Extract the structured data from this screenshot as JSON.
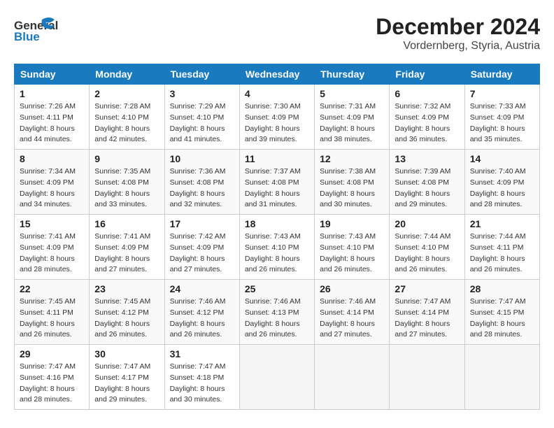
{
  "header": {
    "logo": {
      "general": "General",
      "blue": "Blue"
    },
    "title": "December 2024",
    "subtitle": "Vordernberg, Styria, Austria"
  },
  "calendar": {
    "days_of_week": [
      "Sunday",
      "Monday",
      "Tuesday",
      "Wednesday",
      "Thursday",
      "Friday",
      "Saturday"
    ],
    "weeks": [
      [
        {
          "day": "",
          "empty": true
        },
        {
          "day": "",
          "empty": true
        },
        {
          "day": "",
          "empty": true
        },
        {
          "day": "",
          "empty": true
        },
        {
          "day": "",
          "empty": true
        },
        {
          "day": "",
          "empty": true
        },
        {
          "day": "",
          "empty": true
        }
      ],
      [
        {
          "day": "1",
          "sunrise": "7:26 AM",
          "sunset": "4:11 PM",
          "daylight": "8 hours and 44 minutes."
        },
        {
          "day": "2",
          "sunrise": "7:28 AM",
          "sunset": "4:10 PM",
          "daylight": "8 hours and 42 minutes."
        },
        {
          "day": "3",
          "sunrise": "7:29 AM",
          "sunset": "4:10 PM",
          "daylight": "8 hours and 41 minutes."
        },
        {
          "day": "4",
          "sunrise": "7:30 AM",
          "sunset": "4:09 PM",
          "daylight": "8 hours and 39 minutes."
        },
        {
          "day": "5",
          "sunrise": "7:31 AM",
          "sunset": "4:09 PM",
          "daylight": "8 hours and 38 minutes."
        },
        {
          "day": "6",
          "sunrise": "7:32 AM",
          "sunset": "4:09 PM",
          "daylight": "8 hours and 36 minutes."
        },
        {
          "day": "7",
          "sunrise": "7:33 AM",
          "sunset": "4:09 PM",
          "daylight": "8 hours and 35 minutes."
        }
      ],
      [
        {
          "day": "8",
          "sunrise": "7:34 AM",
          "sunset": "4:09 PM",
          "daylight": "8 hours and 34 minutes."
        },
        {
          "day": "9",
          "sunrise": "7:35 AM",
          "sunset": "4:08 PM",
          "daylight": "8 hours and 33 minutes."
        },
        {
          "day": "10",
          "sunrise": "7:36 AM",
          "sunset": "4:08 PM",
          "daylight": "8 hours and 32 minutes."
        },
        {
          "day": "11",
          "sunrise": "7:37 AM",
          "sunset": "4:08 PM",
          "daylight": "8 hours and 31 minutes."
        },
        {
          "day": "12",
          "sunrise": "7:38 AM",
          "sunset": "4:08 PM",
          "daylight": "8 hours and 30 minutes."
        },
        {
          "day": "13",
          "sunrise": "7:39 AM",
          "sunset": "4:08 PM",
          "daylight": "8 hours and 29 minutes."
        },
        {
          "day": "14",
          "sunrise": "7:40 AM",
          "sunset": "4:09 PM",
          "daylight": "8 hours and 28 minutes."
        }
      ],
      [
        {
          "day": "15",
          "sunrise": "7:41 AM",
          "sunset": "4:09 PM",
          "daylight": "8 hours and 28 minutes."
        },
        {
          "day": "16",
          "sunrise": "7:41 AM",
          "sunset": "4:09 PM",
          "daylight": "8 hours and 27 minutes."
        },
        {
          "day": "17",
          "sunrise": "7:42 AM",
          "sunset": "4:09 PM",
          "daylight": "8 hours and 27 minutes."
        },
        {
          "day": "18",
          "sunrise": "7:43 AM",
          "sunset": "4:10 PM",
          "daylight": "8 hours and 26 minutes."
        },
        {
          "day": "19",
          "sunrise": "7:43 AM",
          "sunset": "4:10 PM",
          "daylight": "8 hours and 26 minutes."
        },
        {
          "day": "20",
          "sunrise": "7:44 AM",
          "sunset": "4:10 PM",
          "daylight": "8 hours and 26 minutes."
        },
        {
          "day": "21",
          "sunrise": "7:44 AM",
          "sunset": "4:11 PM",
          "daylight": "8 hours and 26 minutes."
        }
      ],
      [
        {
          "day": "22",
          "sunrise": "7:45 AM",
          "sunset": "4:11 PM",
          "daylight": "8 hours and 26 minutes."
        },
        {
          "day": "23",
          "sunrise": "7:45 AM",
          "sunset": "4:12 PM",
          "daylight": "8 hours and 26 minutes."
        },
        {
          "day": "24",
          "sunrise": "7:46 AM",
          "sunset": "4:12 PM",
          "daylight": "8 hours and 26 minutes."
        },
        {
          "day": "25",
          "sunrise": "7:46 AM",
          "sunset": "4:13 PM",
          "daylight": "8 hours and 26 minutes."
        },
        {
          "day": "26",
          "sunrise": "7:46 AM",
          "sunset": "4:14 PM",
          "daylight": "8 hours and 27 minutes."
        },
        {
          "day": "27",
          "sunrise": "7:47 AM",
          "sunset": "4:14 PM",
          "daylight": "8 hours and 27 minutes."
        },
        {
          "day": "28",
          "sunrise": "7:47 AM",
          "sunset": "4:15 PM",
          "daylight": "8 hours and 28 minutes."
        }
      ],
      [
        {
          "day": "29",
          "sunrise": "7:47 AM",
          "sunset": "4:16 PM",
          "daylight": "8 hours and 28 minutes."
        },
        {
          "day": "30",
          "sunrise": "7:47 AM",
          "sunset": "4:17 PM",
          "daylight": "8 hours and 29 minutes."
        },
        {
          "day": "31",
          "sunrise": "7:47 AM",
          "sunset": "4:18 PM",
          "daylight": "8 hours and 30 minutes."
        },
        {
          "day": "",
          "empty": true
        },
        {
          "day": "",
          "empty": true
        },
        {
          "day": "",
          "empty": true
        },
        {
          "day": "",
          "empty": true
        }
      ]
    ]
  }
}
